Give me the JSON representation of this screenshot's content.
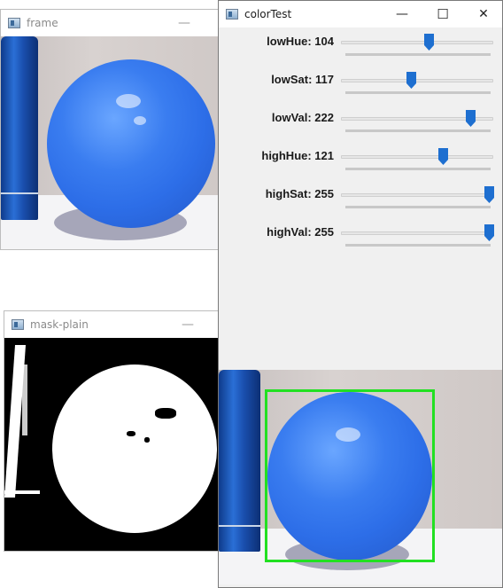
{
  "windows": {
    "frame": {
      "title": "frame",
      "min_glyph": "—"
    },
    "mask": {
      "title": "mask-plain",
      "min_glyph": "—"
    },
    "colorTest": {
      "title": "colorTest",
      "min_glyph": "—",
      "max_glyph": "☐",
      "close_glyph": "✕"
    }
  },
  "trackbars": [
    {
      "label": "lowHue: 104",
      "value": 104,
      "max": 179
    },
    {
      "label": "lowSat: 117",
      "value": 117,
      "max": 255
    },
    {
      "label": "lowVal: 222",
      "value": 222,
      "max": 255
    },
    {
      "label": "highHue: 121",
      "value": 121,
      "max": 179
    },
    {
      "label": "highSat: 255",
      "value": 255,
      "max": 255
    },
    {
      "label": "highVal: 255",
      "value": 255,
      "max": 255
    }
  ],
  "colors": {
    "thumb": "#1e6fd0",
    "detection_box": "#22e022"
  }
}
